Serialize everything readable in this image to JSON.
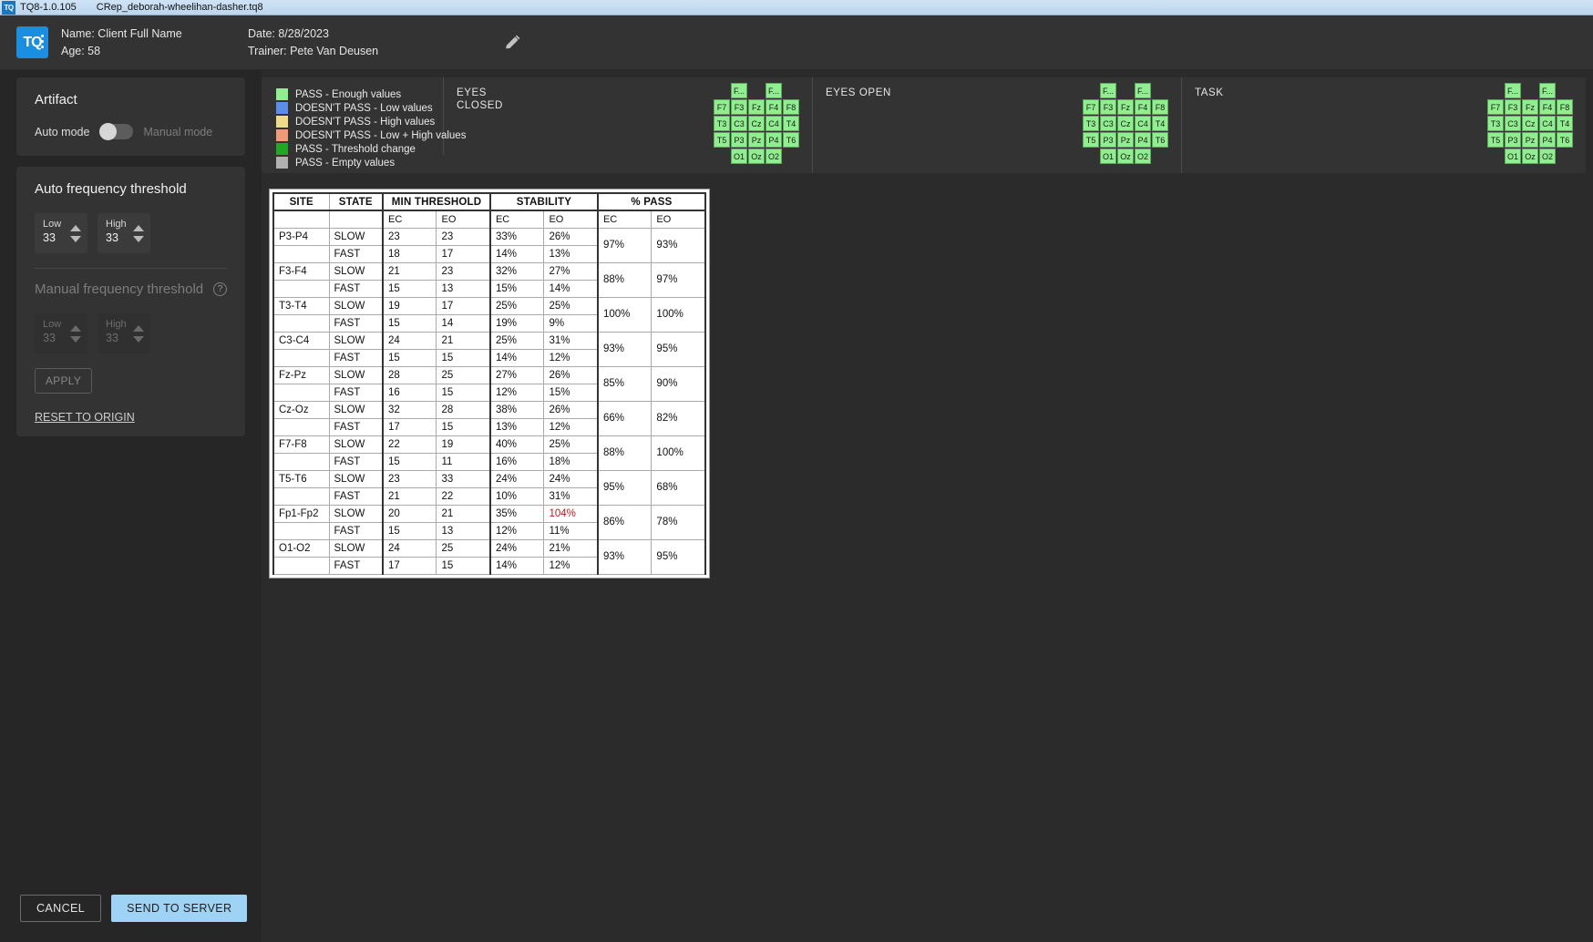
{
  "titlebar": {
    "icon": "app-icon",
    "version": "TQ8-1.0.105",
    "filename": "CRep_deborah-wheelihan-dasher.tq8"
  },
  "header": {
    "logo_text": "TQ",
    "name": "Name: Client Full Name",
    "age": "Age: 58",
    "date": "Date: 8/28/2023",
    "trainer": "Trainer: Pete Van Deusen",
    "edit_icon": "pencil-icon"
  },
  "sidebar": {
    "artifact": {
      "title": "Artifact",
      "auto_label": "Auto mode",
      "manual_label": "Manual mode",
      "toggle_state": "auto"
    },
    "auto_threshold": {
      "title": "Auto frequency threshold",
      "low_label": "Low",
      "low_value": "33",
      "high_label": "High",
      "high_value": "33"
    },
    "manual_threshold": {
      "title": "Manual frequency threshold",
      "help_icon": "question-mark-icon",
      "low_label": "Low",
      "low_value": "33",
      "high_label": "High",
      "high_value": "33",
      "apply_label": "APPLY",
      "disabled": true
    },
    "reset_link": "RESET TO ORIGIN",
    "cancel_label": "CANCEL",
    "send_label": "SEND TO SERVER"
  },
  "colors": {
    "pass_enough": "#90ee90",
    "fail_low": "#5b8eea",
    "fail_high": "#efd98a",
    "fail_low_high": "#ef9b7a",
    "pass_threshold_change": "#21a721",
    "pass_empty": "#b0b0b0",
    "accent_button": "#9fd3f5",
    "alert_text": "#b02020"
  },
  "legend": [
    {
      "color": "#90ee90",
      "label": "PASS - Enough values"
    },
    {
      "color": "#5b8eea",
      "label": "DOESN'T PASS - Low values"
    },
    {
      "color": "#efd98a",
      "label": "DOESN'T PASS - High values"
    },
    {
      "color": "#ef9b7a",
      "label": "DOESN'T PASS - Low + High values"
    },
    {
      "color": "#21a721",
      "label": "PASS - Threshold change"
    },
    {
      "color": "#b0b0b0",
      "label": "PASS - Empty values"
    }
  ],
  "head_maps": [
    {
      "title": "EYES\nCLOSED",
      "rows": [
        [
          "",
          "F...",
          "",
          "F...",
          ""
        ],
        [
          "F7",
          "F3",
          "Fz",
          "F4",
          "F8"
        ],
        [
          "T3",
          "C3",
          "Cz",
          "C4",
          "T4"
        ],
        [
          "T5",
          "P3",
          "Pz",
          "P4",
          "T6"
        ],
        [
          "",
          "O1",
          "Oz",
          "O2",
          ""
        ]
      ]
    },
    {
      "title": "EYES OPEN",
      "rows": [
        [
          "",
          "F...",
          "",
          "F...",
          ""
        ],
        [
          "F7",
          "F3",
          "Fz",
          "F4",
          "F8"
        ],
        [
          "T3",
          "C3",
          "Cz",
          "C4",
          "T4"
        ],
        [
          "T5",
          "P3",
          "Pz",
          "P4",
          "T6"
        ],
        [
          "",
          "O1",
          "Oz",
          "O2",
          ""
        ]
      ]
    },
    {
      "title": "TASK",
      "rows": [
        [
          "",
          "F...",
          "",
          "F...",
          ""
        ],
        [
          "F7",
          "F3",
          "Fz",
          "F4",
          "F8"
        ],
        [
          "T3",
          "C3",
          "Cz",
          "C4",
          "T4"
        ],
        [
          "T5",
          "P3",
          "Pz",
          "P4",
          "T6"
        ],
        [
          "",
          "O1",
          "Oz",
          "O2",
          ""
        ]
      ]
    }
  ],
  "table": {
    "group_headers": [
      "SITE",
      "STATE",
      "MIN THRESHOLD",
      "STABILITY",
      "% PASS"
    ],
    "sub_headers": [
      "",
      "",
      "EC",
      "EO",
      "EC",
      "EO",
      "EC",
      "EO"
    ],
    "groups": [
      {
        "site": "P3-P4",
        "pass_ec": "97%",
        "pass_eo": "93%",
        "rows": [
          {
            "state": "SLOW",
            "min_ec": "23",
            "min_eo": "23",
            "stab_ec": "33%",
            "stab_eo": "26%"
          },
          {
            "state": "FAST",
            "min_ec": "18",
            "min_eo": "17",
            "stab_ec": "14%",
            "stab_eo": "13%"
          }
        ]
      },
      {
        "site": "F3-F4",
        "pass_ec": "88%",
        "pass_eo": "97%",
        "rows": [
          {
            "state": "SLOW",
            "min_ec": "21",
            "min_eo": "23",
            "stab_ec": "32%",
            "stab_eo": "27%"
          },
          {
            "state": "FAST",
            "min_ec": "15",
            "min_eo": "13",
            "stab_ec": "15%",
            "stab_eo": "14%"
          }
        ]
      },
      {
        "site": "T3-T4",
        "pass_ec": "100%",
        "pass_eo": "100%",
        "rows": [
          {
            "state": "SLOW",
            "min_ec": "19",
            "min_eo": "17",
            "stab_ec": "25%",
            "stab_eo": "25%"
          },
          {
            "state": "FAST",
            "min_ec": "15",
            "min_eo": "14",
            "stab_ec": "19%",
            "stab_eo": "9%"
          }
        ]
      },
      {
        "site": "C3-C4",
        "pass_ec": "93%",
        "pass_eo": "95%",
        "rows": [
          {
            "state": "SLOW",
            "min_ec": "24",
            "min_eo": "21",
            "stab_ec": "25%",
            "stab_eo": "31%"
          },
          {
            "state": "FAST",
            "min_ec": "15",
            "min_eo": "15",
            "stab_ec": "14%",
            "stab_eo": "12%"
          }
        ]
      },
      {
        "site": "Fz-Pz",
        "pass_ec": "85%",
        "pass_eo": "90%",
        "rows": [
          {
            "state": "SLOW",
            "min_ec": "28",
            "min_eo": "25",
            "stab_ec": "27%",
            "stab_eo": "26%"
          },
          {
            "state": "FAST",
            "min_ec": "16",
            "min_eo": "15",
            "stab_ec": "12%",
            "stab_eo": "15%"
          }
        ]
      },
      {
        "site": "Cz-Oz",
        "pass_ec": "66%",
        "pass_eo": "82%",
        "rows": [
          {
            "state": "SLOW",
            "min_ec": "32",
            "min_eo": "28",
            "stab_ec": "38%",
            "stab_eo": "26%"
          },
          {
            "state": "FAST",
            "min_ec": "17",
            "min_eo": "15",
            "stab_ec": "13%",
            "stab_eo": "12%"
          }
        ]
      },
      {
        "site": "F7-F8",
        "pass_ec": "88%",
        "pass_eo": "100%",
        "rows": [
          {
            "state": "SLOW",
            "min_ec": "22",
            "min_eo": "19",
            "stab_ec": "40%",
            "stab_eo": "25%"
          },
          {
            "state": "FAST",
            "min_ec": "15",
            "min_eo": "11",
            "stab_ec": "16%",
            "stab_eo": "18%"
          }
        ]
      },
      {
        "site": "T5-T6",
        "pass_ec": "95%",
        "pass_eo": "68%",
        "rows": [
          {
            "state": "SLOW",
            "min_ec": "23",
            "min_eo": "33",
            "stab_ec": "24%",
            "stab_eo": "24%"
          },
          {
            "state": "FAST",
            "min_ec": "21",
            "min_eo": "22",
            "stab_ec": "10%",
            "stab_eo": "31%"
          }
        ]
      },
      {
        "site": "Fp1-Fp2",
        "pass_ec": "86%",
        "pass_eo": "78%",
        "rows": [
          {
            "state": "SLOW",
            "min_ec": "20",
            "min_eo": "21",
            "stab_ec": "35%",
            "stab_eo": "104%",
            "stab_eo_alert": true
          },
          {
            "state": "FAST",
            "min_ec": "15",
            "min_eo": "13",
            "stab_ec": "12%",
            "stab_eo": "11%"
          }
        ]
      },
      {
        "site": "O1-O2",
        "pass_ec": "93%",
        "pass_eo": "95%",
        "rows": [
          {
            "state": "SLOW",
            "min_ec": "24",
            "min_eo": "25",
            "stab_ec": "24%",
            "stab_eo": "21%"
          },
          {
            "state": "FAST",
            "min_ec": "17",
            "min_eo": "15",
            "stab_ec": "14%",
            "stab_eo": "12%"
          }
        ]
      }
    ]
  }
}
